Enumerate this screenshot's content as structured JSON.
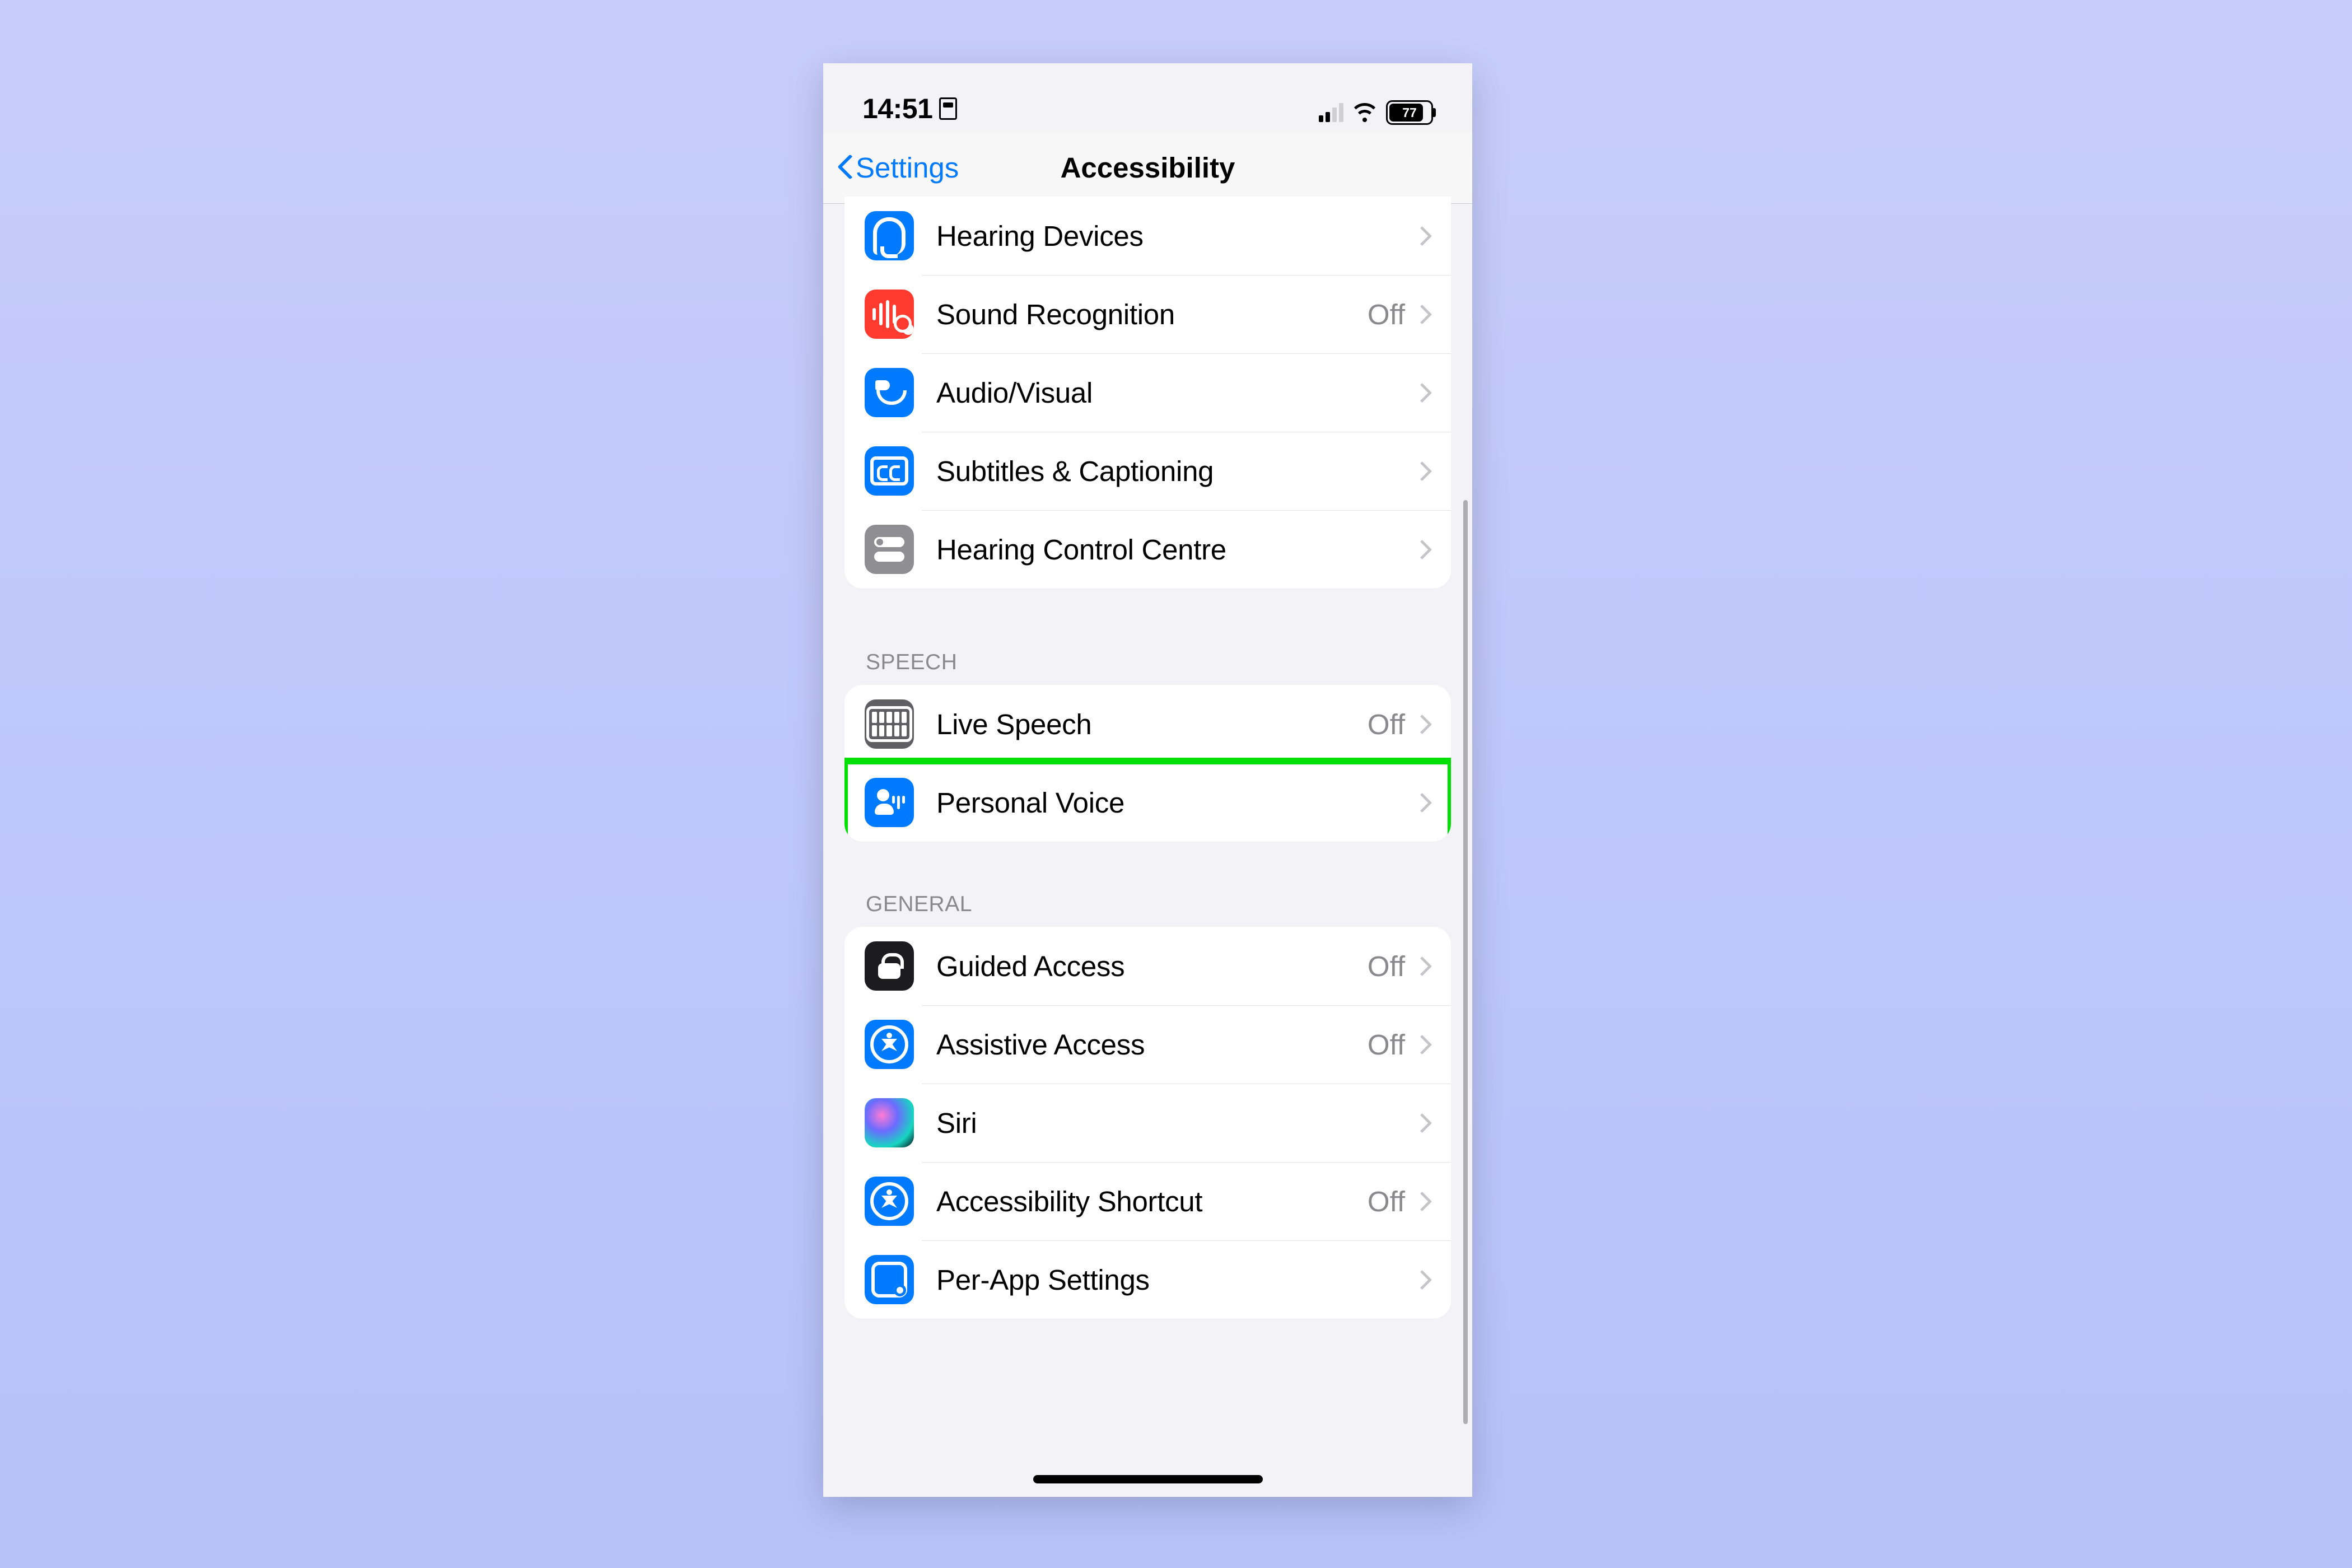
{
  "status": {
    "time": "14:51",
    "battery_pct": "77"
  },
  "nav": {
    "back_label": "Settings",
    "title": "Accessibility"
  },
  "hearing_group": {
    "items": [
      {
        "label": "Hearing Devices",
        "value": ""
      },
      {
        "label": "Sound Recognition",
        "value": "Off"
      },
      {
        "label": "Audio/Visual",
        "value": ""
      },
      {
        "label": "Subtitles & Captioning",
        "value": ""
      },
      {
        "label": "Hearing Control Centre",
        "value": ""
      }
    ]
  },
  "speech_group": {
    "header": "SPEECH",
    "items": [
      {
        "label": "Live Speech",
        "value": "Off"
      },
      {
        "label": "Personal Voice",
        "value": ""
      }
    ]
  },
  "general_group": {
    "header": "GENERAL",
    "items": [
      {
        "label": "Guided Access",
        "value": "Off"
      },
      {
        "label": "Assistive Access",
        "value": "Off"
      },
      {
        "label": "Siri",
        "value": ""
      },
      {
        "label": "Accessibility Shortcut",
        "value": "Off"
      },
      {
        "label": "Per-App Settings",
        "value": ""
      }
    ]
  },
  "highlight": {
    "target": "Personal Voice"
  },
  "colors": {
    "ios_blue": "#007aff",
    "ios_red": "#ff3b30",
    "ios_grey": "#8e8e93",
    "highlight": "#00e000",
    "page_bg": "#f2f2f7"
  }
}
